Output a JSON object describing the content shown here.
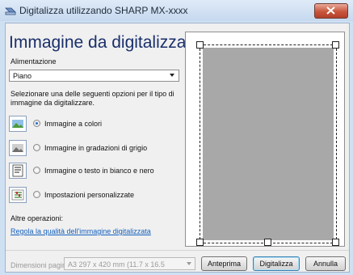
{
  "window": {
    "title": "Digitalizza utilizzando SHARP MX-xxxx",
    "close_icon": "close-icon"
  },
  "left": {
    "heading": "Immagine da digitalizzare:",
    "feed_label": "Alimentazione",
    "feed_value": "Piano",
    "instructions": "Selezionare una delle seguenti opzioni per il tipo di immagine da digitalizzare.",
    "options": [
      {
        "label": "Immagine a colori",
        "icon": "color-picture-icon",
        "selected": true
      },
      {
        "label": "Immagine in gradazioni di grigio",
        "icon": "grayscale-picture-icon",
        "selected": false
      },
      {
        "label": "Immagine o testo in bianco e nero",
        "icon": "black-white-text-icon",
        "selected": false
      },
      {
        "label": "Impostazioni personalizzate",
        "icon": "custom-settings-icon",
        "selected": false
      }
    ],
    "other_label": "Altre operazioni:",
    "adjust_link": "Regola la qualità dell'immagine digitalizzata"
  },
  "bottom": {
    "page_size_label": "Dimensioni pagina:",
    "page_size_value": "A3 297 x 420 mm (11.7 x 16.5",
    "preview_button": "Anteprima",
    "scan_button": "Digitalizza",
    "cancel_button": "Annulla"
  },
  "colors": {
    "heading": "#1a2f6b",
    "link": "#1560bd",
    "close": "#c8563c",
    "preview_area": "#a8a8a8"
  }
}
